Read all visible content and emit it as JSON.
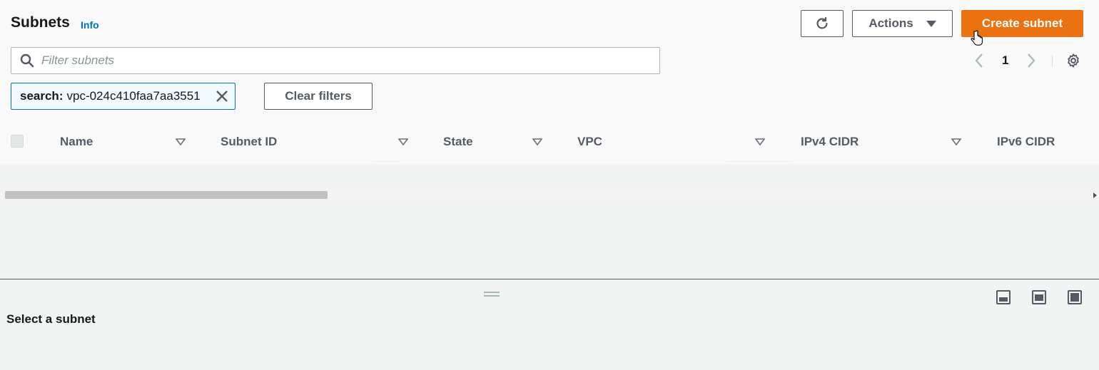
{
  "header": {
    "title": "Subnets",
    "info_link": "Info"
  },
  "toolbar": {
    "refresh_icon": "refresh-icon",
    "actions_label": "Actions",
    "create_label": "Create subnet"
  },
  "search": {
    "placeholder": "Filter subnets",
    "value": ""
  },
  "pagination": {
    "current_page": "1"
  },
  "filter_token": {
    "key": "search:",
    "value": "vpc-024c410faa7aa3551"
  },
  "clear_filters_label": "Clear filters",
  "table": {
    "columns": [
      "Name",
      "Subnet ID",
      "State",
      "VPC",
      "IPv4 CIDR",
      "IPv6 CIDR"
    ]
  },
  "split_panel": {
    "empty_label": "Select a subnet"
  },
  "colors": {
    "primary_button": "#ec7211",
    "link": "#0073bb",
    "filter_token_border": "#0073bb"
  }
}
